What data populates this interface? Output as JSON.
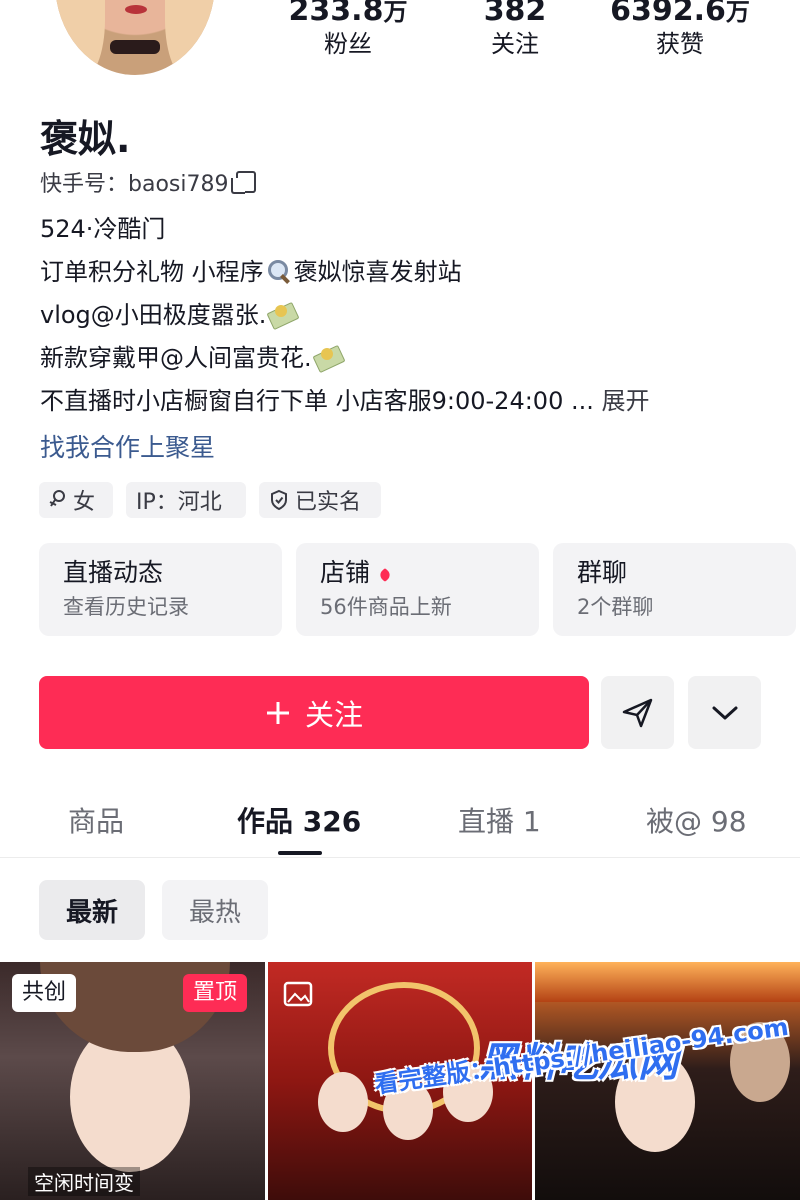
{
  "stats": [
    {
      "num": "233.8",
      "unit": "万",
      "label": "粉丝"
    },
    {
      "num": "382",
      "unit": "",
      "label": "关注"
    },
    {
      "num": "6392.6",
      "unit": "万",
      "label": "获赞"
    }
  ],
  "profile": {
    "name": "褒姒.",
    "kuaishou_id": "快手号：baosi789"
  },
  "bio": {
    "line1": "524·冷酷门",
    "line2_a": "订单积分礼物 小程序",
    "line2_b": "褒姒惊喜发射站",
    "line3": "vlog@小田极度嚣张.",
    "line4": "新款穿戴甲@人间富贵花.",
    "line5": "不直播时小店橱窗自行下单 小店客服9:00-24:00 ... ",
    "expand": "展开",
    "link": "找我合作上聚星"
  },
  "tags": [
    {
      "icon": "female-icon",
      "label": "女"
    },
    {
      "icon": "",
      "label": "IP：河北"
    },
    {
      "icon": "shield-check-icon",
      "label": "已实名"
    }
  ],
  "cards": [
    {
      "title": "直播动态",
      "subtitle": "查看历史记录"
    },
    {
      "title": "店铺",
      "subtitle": "56件商品上新"
    },
    {
      "title": "群聊",
      "subtitle": "2个群聊"
    }
  ],
  "actions": {
    "follow_label": "关注",
    "follow_icon": "plus-icon",
    "send_icon": "paper-plane-icon",
    "more_icon": "chevron-down-icon"
  },
  "tabs": [
    {
      "label": "商品",
      "active": false
    },
    {
      "label": "作品 326",
      "active": true
    },
    {
      "label": "直播 1",
      "active": false
    },
    {
      "label": "被@ 98",
      "active": false
    }
  ],
  "filters": [
    {
      "label": "最新",
      "active": true
    },
    {
      "label": "最热",
      "active": false
    }
  ],
  "thumbs": {
    "first_badge_left": "共创",
    "first_badge_right": "置顶",
    "first_caption": "空闲时间变"
  },
  "watermark": {
    "title": "黑料吃瓜网",
    "line": "看完整版：https://heiliao-94.com"
  },
  "colors": {
    "accent": "#fe2c55",
    "link": "#3b5a8f"
  }
}
